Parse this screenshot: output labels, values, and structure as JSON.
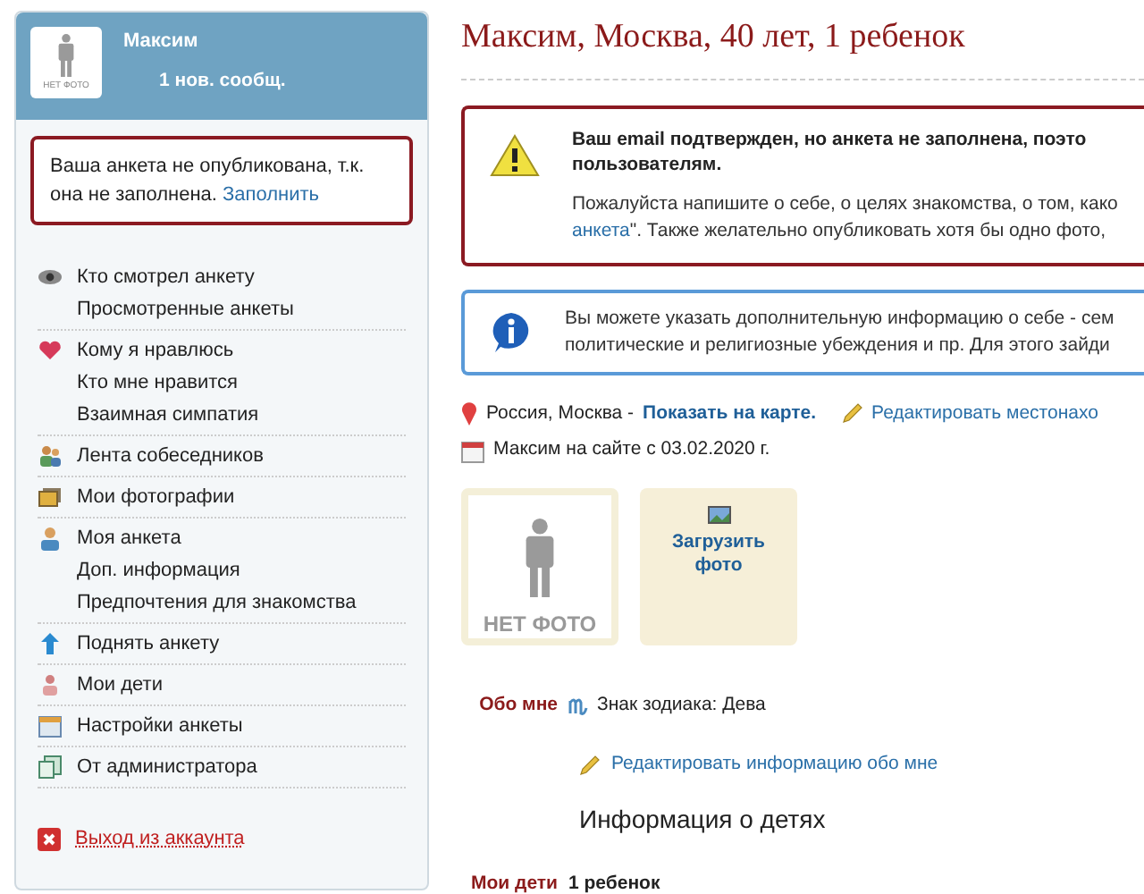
{
  "sidebar": {
    "user": {
      "name": "Максим",
      "messages": "1 нов. сообщ.",
      "photo_label": "НЕТ ФОТО"
    },
    "notice": {
      "text": "Ваша анкета не опубликована, т.к. она не заполнена.",
      "link": "Заполнить"
    },
    "groups": [
      {
        "items": [
          {
            "label": "Кто смотрел анкету",
            "kind": "eye"
          },
          {
            "label": "Просмотренные анкеты",
            "kind": "plain"
          }
        ]
      },
      {
        "items": [
          {
            "label": "Кому я нравлюсь",
            "kind": "heart"
          },
          {
            "label": "Кто мне нравится",
            "kind": "plain"
          },
          {
            "label": "Взаимная симпатия",
            "kind": "plain"
          }
        ]
      },
      {
        "items": [
          {
            "label": "Лента собеседников",
            "kind": "people"
          }
        ]
      },
      {
        "items": [
          {
            "label": "Мои фотографии",
            "kind": "photos"
          }
        ]
      },
      {
        "items": [
          {
            "label": "Моя анкета",
            "kind": "person"
          },
          {
            "label": "Доп. информация",
            "kind": "plain"
          },
          {
            "label": "Предпочтения для знакомства",
            "kind": "plain"
          }
        ]
      },
      {
        "items": [
          {
            "label": "Поднять анкету",
            "kind": "arrow"
          }
        ]
      },
      {
        "items": [
          {
            "label": "Мои дети",
            "kind": "child"
          }
        ]
      },
      {
        "items": [
          {
            "label": "Настройки анкеты",
            "kind": "settings"
          }
        ]
      },
      {
        "items": [
          {
            "label": "От администратора",
            "kind": "copy"
          }
        ]
      }
    ],
    "logout": "Выход из аккаунта"
  },
  "main": {
    "title": "Максим, Москва, 40 лет, 1 ребенок",
    "warning": {
      "heading": [
        "Ваш email подтвержден, но анкета не заполнена, поэто",
        "пользователям."
      ],
      "body_start": "Пожалуйста напишите о себе, о целях знакомства, о том, како",
      "body_link": "анкета",
      "body_end": "\". Также желательно опубликовать хотя бы одно фото,"
    },
    "info": {
      "lines": [
        "Вы можете указать дополнительную информацию о себе - сем",
        "политические и религиозные убеждения и пр. Для этого зайди"
      ]
    },
    "location": {
      "text": "Россия, Москва -",
      "map_link": "Показать на карте.",
      "edit_link": "Редактировать местонахо"
    },
    "since": "Максим на сайте с 03.02.2020 г.",
    "photo": {
      "label": "НЕТ ФОТО"
    },
    "upload": "Загрузить фото",
    "about": {
      "label": "Обо мне",
      "zodiac": "Знак зодиака: Дева",
      "edit_link": "Редактировать информацию обо мне"
    },
    "kids_heading": "Информация о детях",
    "kids": {
      "label": "Мои дети",
      "value": "1 ребенок"
    }
  }
}
